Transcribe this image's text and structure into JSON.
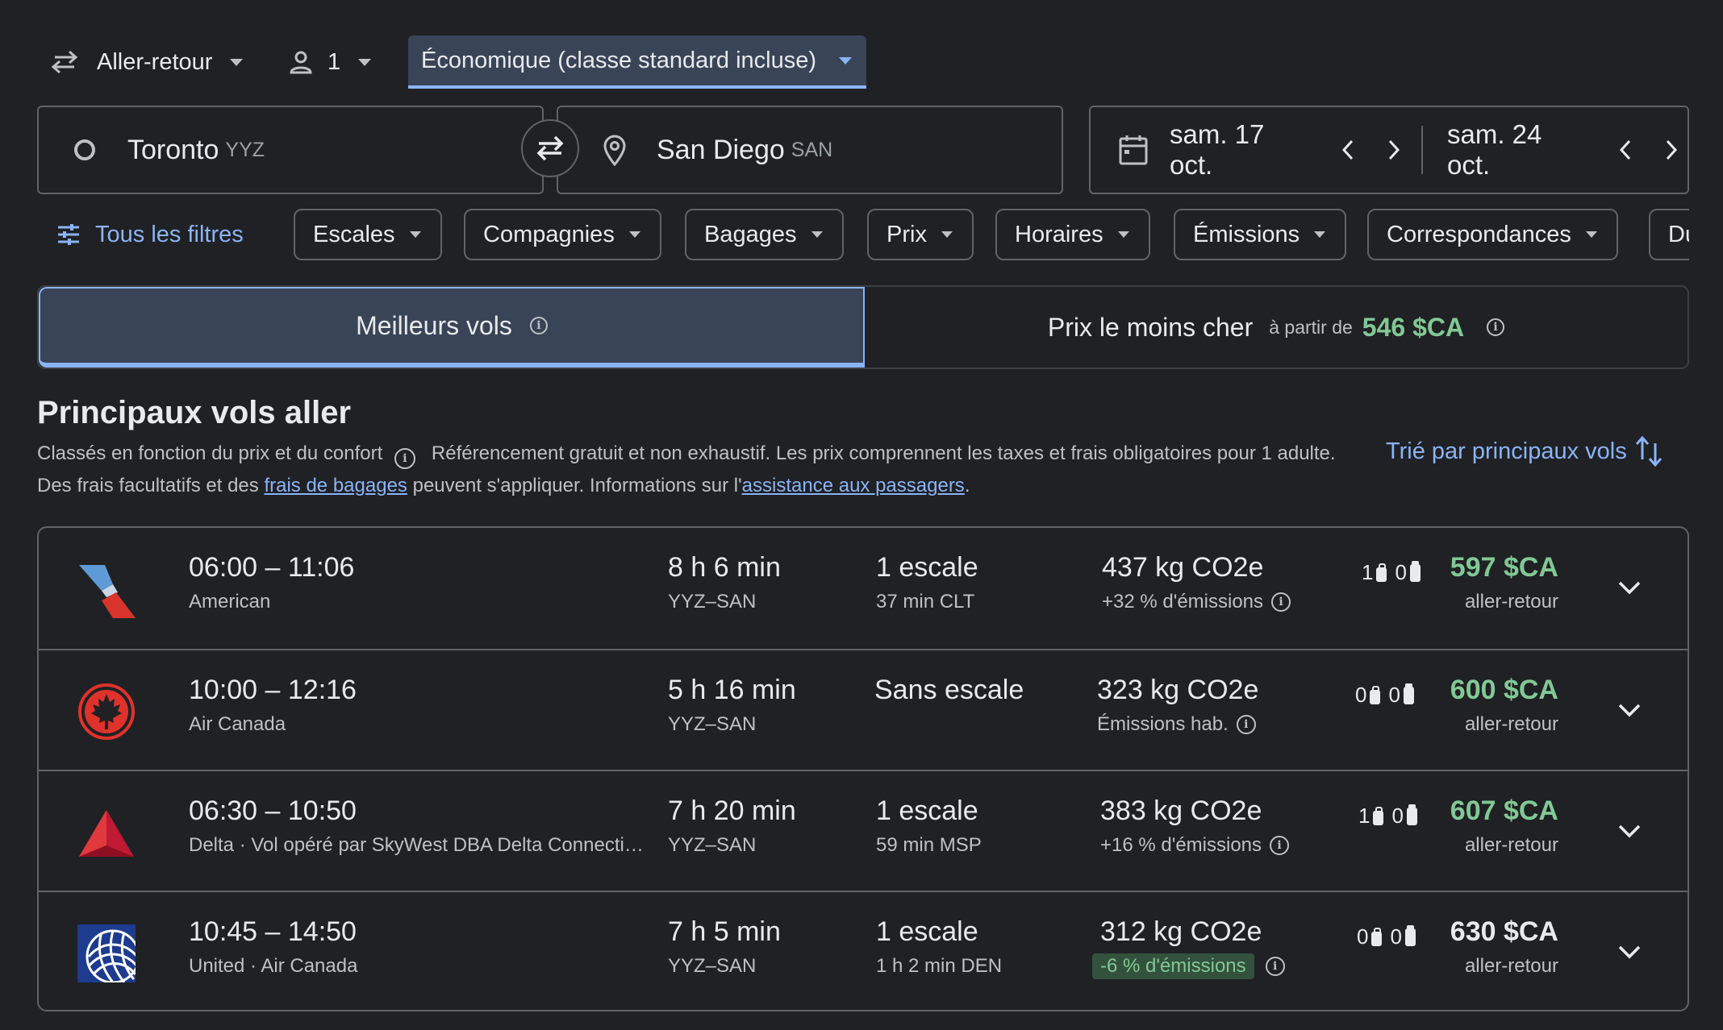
{
  "search": {
    "trip_type": "Aller-retour",
    "passengers": "1",
    "cabin_class": "Économique (classe standard incluse)",
    "origin_city": "Toronto",
    "origin_code": "YYZ",
    "destination_city": "San Diego",
    "destination_code": "SAN",
    "depart_date": "sam. 17 oct.",
    "return_date": "sam. 24 oct."
  },
  "filters": {
    "all_filters_label": "Tous les filtres",
    "chips": [
      "Escales",
      "Compagnies",
      "Bagages",
      "Prix",
      "Horaires",
      "Émissions",
      "Correspondances",
      "Du"
    ]
  },
  "tabs": {
    "best_label": "Meilleurs vols",
    "cheapest_label": "Prix le moins cher",
    "cheapest_from": "à partir de",
    "cheapest_price": "546 $CA"
  },
  "section": {
    "title": "Principaux vols aller",
    "ranking_text": "Classés en fonction du prix et du confort",
    "desc_part1": "Référencement gratuit et non exhaustif. Les prix comprennent les taxes et frais obligatoires pour 1 adulte. Des frais facultatifs et des ",
    "baggage_link": "frais de bagages",
    "desc_part2": " peuvent s'appliquer. Informations sur l'",
    "assistance_link": "assistance aux passagers",
    "desc_part3": ".",
    "sort_label": "Trié par principaux vols"
  },
  "flights": [
    {
      "times": "06:00 – 11:06",
      "airline": "American",
      "duration": "8 h 6 min",
      "route": "YYZ–SAN",
      "stops": "1 escale",
      "stop_info": "37 min CLT",
      "co2": "437 kg CO2e",
      "co2_note": "+32 % d'émissions",
      "carry_on": "1",
      "checked": "0",
      "price": "597 $CA",
      "price_color": "#81c995",
      "price_type": "aller-retour",
      "logo": "american-airlines-logo"
    },
    {
      "times": "10:00 – 12:16",
      "airline": "Air Canada",
      "duration": "5 h 16 min",
      "route": "YYZ–SAN",
      "stops": "Sans escale",
      "stop_info": "",
      "co2": "323 kg CO2e",
      "co2_note": "Émissions hab.",
      "carry_on": "0",
      "checked": "0",
      "price": "600 $CA",
      "price_color": "#81c995",
      "price_type": "aller-retour",
      "logo": "air-canada-logo"
    },
    {
      "times": "06:30 – 10:50",
      "airline": "Delta · Vol opéré par SkyWest DBA Delta Connecti…",
      "duration": "7 h 20 min",
      "route": "YYZ–SAN",
      "stops": "1 escale",
      "stop_info": "59 min MSP",
      "co2": "383 kg CO2e",
      "co2_note": "+16 % d'émissions",
      "carry_on": "1",
      "checked": "0",
      "price": "607 $CA",
      "price_color": "#81c995",
      "price_type": "aller-retour",
      "logo": "delta-logo"
    },
    {
      "times": "10:45 – 14:50",
      "airline": "United · Air Canada",
      "duration": "7 h 5 min",
      "route": "YYZ–SAN",
      "stops": "1 escale",
      "stop_info": "1 h 2 min DEN",
      "co2": "312 kg CO2e",
      "co2_note": "-6 % d'émissions",
      "carry_on": "0",
      "checked": "0",
      "price": "630 $CA",
      "price_color": "#e8eaed",
      "price_type": "aller-retour",
      "logo": "united-logo"
    }
  ],
  "colors": {
    "background": "#202124",
    "accent": "#8ab4f8",
    "price_green": "#81c995"
  }
}
